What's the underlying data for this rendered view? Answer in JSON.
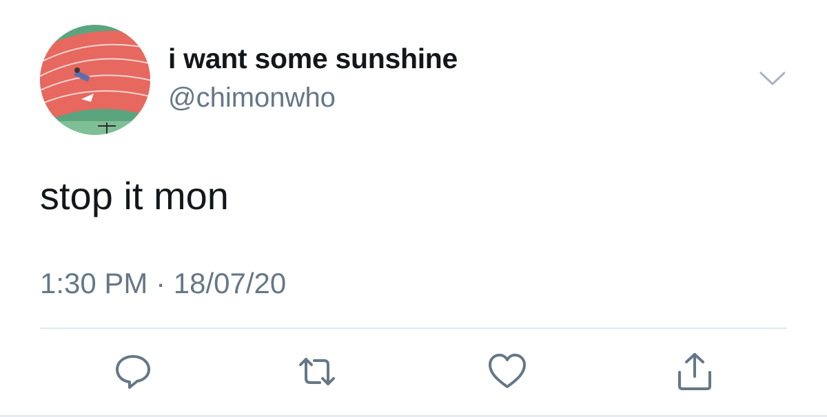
{
  "user": {
    "display_name": "i want some sunshine",
    "handle": "@chimonwho"
  },
  "tweet": {
    "text": "stop it mon",
    "timestamp": "1:30 PM · 18/07/20"
  },
  "icons": {
    "menu": "chevron-down-icon",
    "reply": "reply-icon",
    "retweet": "retweet-icon",
    "like": "heart-icon",
    "share": "share-icon"
  },
  "colors": {
    "text_primary": "#14171a",
    "text_secondary": "#657786",
    "icon": "#657786",
    "divider": "#e1e8ed"
  }
}
